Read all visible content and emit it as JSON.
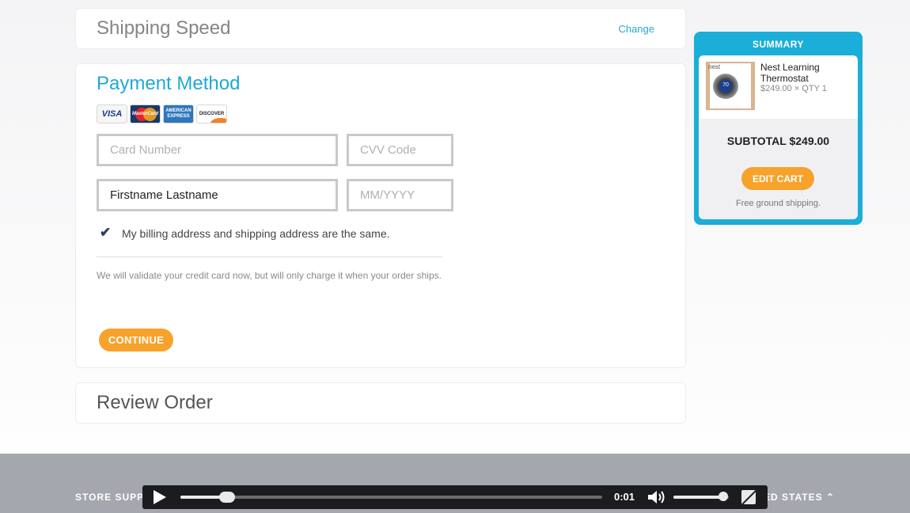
{
  "shipping_speed": {
    "title": "Shipping Speed",
    "change_link": "Change"
  },
  "payment_method": {
    "title": "Payment Method",
    "cards": [
      "VISA",
      "MasterCard",
      "AMERICAN EXPRESS",
      "DISCOVER"
    ],
    "card_number_placeholder": "Card Number",
    "cvv_placeholder": "CVV Code",
    "name_value": "Firstname Lastname",
    "expiry_placeholder": "MM/YYYY",
    "same_address_label": "My billing address and shipping address are the same.",
    "same_address_checked": true,
    "note": "We will validate your credit card now, but will only charge it when your order ships.",
    "continue_label": "CONTINUE"
  },
  "review_order": {
    "title": "Review Order"
  },
  "summary": {
    "header": "SUMMARY",
    "item": {
      "name": "Nest Learning Thermostat",
      "price_qty": "$249.00 × QTY 1",
      "thumb_brand": "nest",
      "thumb_temp": "70"
    },
    "subtotal": "SUBTOTAL $249.00",
    "edit_cart_label": "EDIT CART",
    "shipping_note": "Free ground shipping.",
    "accent_color": "#1aaed9"
  },
  "footer": {
    "store_support": "STORE SUPPORT",
    "country": "UNITED STATES ⌃"
  },
  "video_player": {
    "time": "0:01",
    "progress": 0.11,
    "volume": 0.9
  },
  "colors": {
    "button_orange": "#f7a22b",
    "link_blue": "#2aa6cf"
  }
}
